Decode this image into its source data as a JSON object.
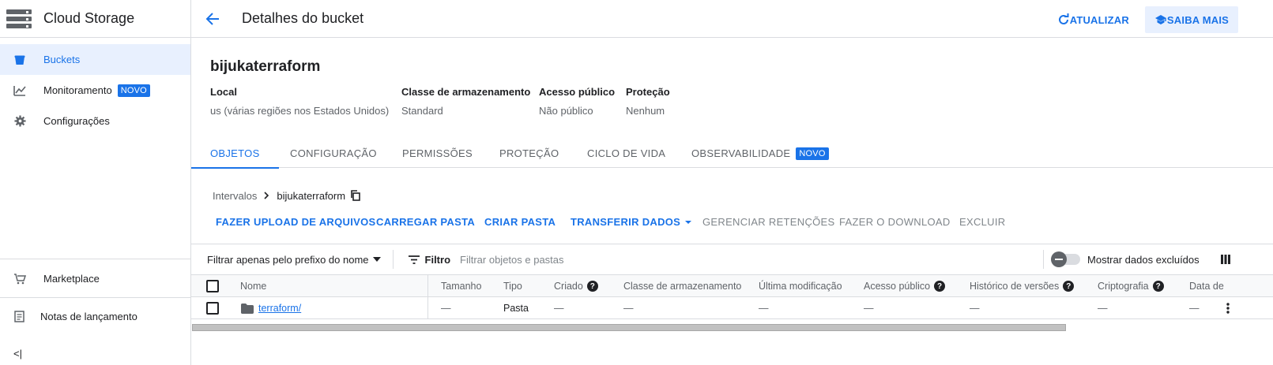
{
  "sidebar": {
    "title": "Cloud Storage",
    "items": [
      {
        "label": "Buckets",
        "icon": "bucket-icon"
      },
      {
        "label": "Monitoramento",
        "icon": "chart-icon",
        "badge": "NOVO"
      },
      {
        "label": "Configurações",
        "icon": "gear-icon"
      }
    ],
    "bottom": [
      {
        "label": "Marketplace",
        "icon": "cart-icon"
      },
      {
        "label": "Notas de lançamento",
        "icon": "notes-icon"
      }
    ],
    "collapse": "<|"
  },
  "header": {
    "title": "Detalhes do bucket",
    "refresh_label": "ATUALIZAR",
    "learn_label": "SAIBA MAIS"
  },
  "bucket": {
    "name": "bijukaterraform",
    "meta": [
      {
        "key": "Local",
        "value": "us (várias regiões nos Estados Unidos)"
      },
      {
        "key": "Classe de armazenamento",
        "value": "Standard"
      },
      {
        "key": "Acesso público",
        "value": "Não público"
      },
      {
        "key": "Proteção",
        "value": "Nenhum"
      }
    ]
  },
  "tabs": [
    {
      "label": "OBJETOS",
      "active": true
    },
    {
      "label": "CONFIGURAÇÃO"
    },
    {
      "label": "PERMISSÕES"
    },
    {
      "label": "PROTEÇÃO"
    },
    {
      "label": "CICLO DE VIDA"
    },
    {
      "label": "OBSERVABILIDADE",
      "badge": "NOVO"
    }
  ],
  "breadcrumb": {
    "root": "Intervalos",
    "current": "bijukaterraform"
  },
  "actions": {
    "upload_files": "FAZER UPLOAD DE ARQUIVOS",
    "upload_folder": "CARREGAR PASTA",
    "create_folder": "CRIAR PASTA",
    "transfer": "TRANSFERIR DADOS",
    "manage_holds": "GERENCIAR RETENÇÕES",
    "download": "FAZER O DOWNLOAD",
    "delete": "EXCLUIR"
  },
  "filter": {
    "prefix_select": "Filtrar apenas pelo prefixo do nome",
    "filter_label": "Filtro",
    "placeholder": "Filtrar objetos e pastas",
    "show_deleted": "Mostrar dados excluídos"
  },
  "table": {
    "columns": [
      "Nome",
      "Tamanho",
      "Tipo",
      "Criado",
      "Classe de armazenamento",
      "Última modificação",
      "Acesso público",
      "Histórico de versões",
      "Criptografia",
      "Data de"
    ],
    "rows": [
      {
        "name": "terraform/",
        "size": "—",
        "type": "Pasta",
        "created": "—",
        "storage_class": "—",
        "modified": "—",
        "public": "—",
        "versions": "—",
        "encryption": "—",
        "date": "—"
      }
    ]
  },
  "colors": {
    "accent": "#1a73e8",
    "active_bg": "#e8f0fe",
    "border": "#dadce0"
  }
}
